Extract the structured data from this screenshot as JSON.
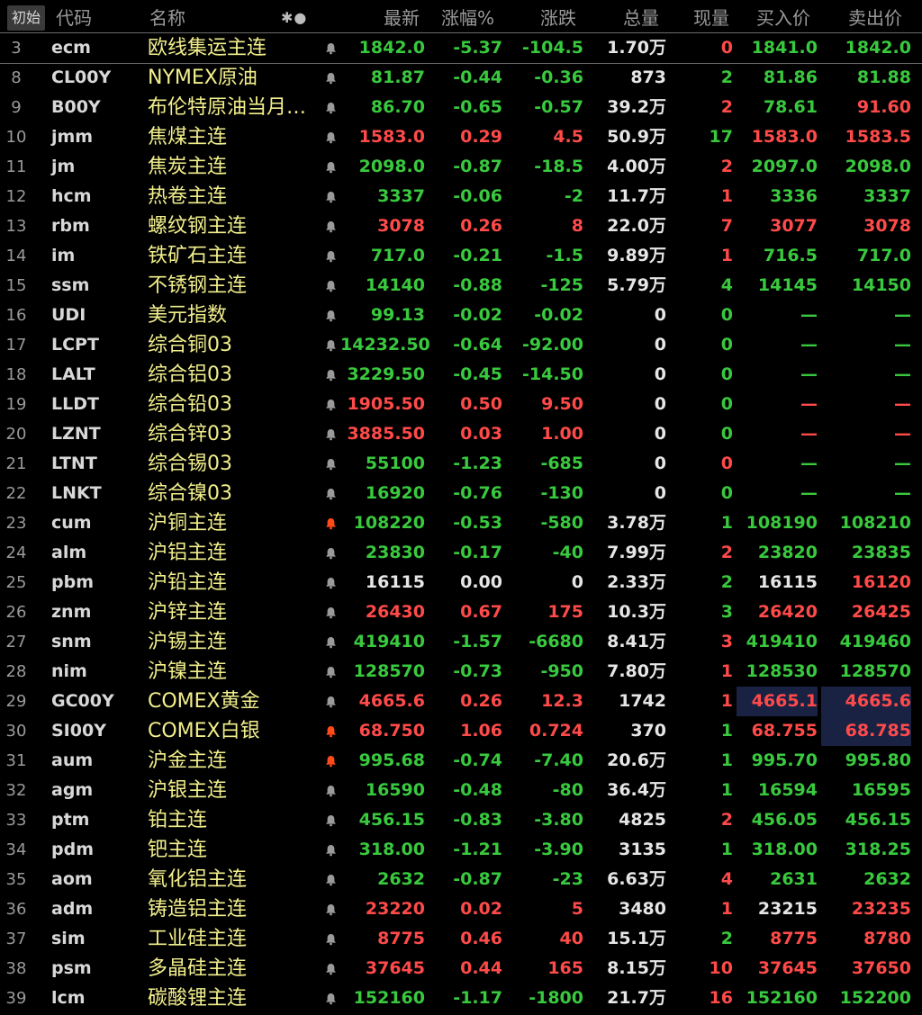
{
  "header": {
    "init_button": "初始",
    "cols": {
      "code": "代码",
      "name": "名称",
      "star": "✱●",
      "last": "最新",
      "pct": "涨幅%",
      "chg": "涨跌",
      "vol": "总量",
      "cur": "现量",
      "bid": "买入价",
      "ask": "卖出价"
    }
  },
  "colors": {
    "up": "#ff4a4a",
    "down": "#39c93e",
    "flat": "#e6e6e6",
    "name": "#f2ef8c",
    "bell_active": "#ff4a1a",
    "bell_idle": "#9a9a9a"
  },
  "rows": [
    {
      "no": "3",
      "code": "ecm",
      "name": "欧线集运主连",
      "bell": "idle",
      "last": "1842.0",
      "pct": "-5.37",
      "chg": "-104.5",
      "vol": "1.70万",
      "cur": "0",
      "bid": "1841.0",
      "ask": "1842.0",
      "c": "g",
      "cc": "red"
    },
    {
      "no": "8",
      "code": "CL00Y",
      "name": "NYMEX原油",
      "bell": "idle",
      "last": "81.87",
      "pct": "-0.44",
      "chg": "-0.36",
      "vol": "873",
      "cur": "2",
      "bid": "81.86",
      "ask": "81.88",
      "c": "g",
      "cc": "g"
    },
    {
      "no": "9",
      "code": "B00Y",
      "name": "布伦特原油当月连续",
      "bell": "idle",
      "last": "86.70",
      "pct": "-0.65",
      "chg": "-0.57",
      "vol": "39.2万",
      "cur": "2",
      "bid": "78.61",
      "ask": "91.60",
      "c": "g",
      "cc": "red",
      "bidc": "g",
      "askc": "red"
    },
    {
      "no": "10",
      "code": "jmm",
      "name": "焦煤主连",
      "bell": "idle",
      "last": "1583.0",
      "pct": "0.29",
      "chg": "4.5",
      "vol": "50.9万",
      "cur": "17",
      "bid": "1583.0",
      "ask": "1583.5",
      "c": "red",
      "cc": "g"
    },
    {
      "no": "11",
      "code": "jm",
      "name": "焦炭主连",
      "bell": "idle",
      "last": "2098.0",
      "pct": "-0.87",
      "chg": "-18.5",
      "vol": "4.00万",
      "cur": "2",
      "bid": "2097.0",
      "ask": "2098.0",
      "c": "g",
      "cc": "red"
    },
    {
      "no": "12",
      "code": "hcm",
      "name": "热卷主连",
      "bell": "idle",
      "last": "3337",
      "pct": "-0.06",
      "chg": "-2",
      "vol": "11.7万",
      "cur": "1",
      "bid": "3336",
      "ask": "3337",
      "c": "g",
      "cc": "red"
    },
    {
      "no": "13",
      "code": "rbm",
      "name": "螺纹钢主连",
      "bell": "idle",
      "last": "3078",
      "pct": "0.26",
      "chg": "8",
      "vol": "22.0万",
      "cur": "7",
      "bid": "3077",
      "ask": "3078",
      "c": "red",
      "cc": "red"
    },
    {
      "no": "14",
      "code": "im",
      "name": "铁矿石主连",
      "bell": "idle",
      "last": "717.0",
      "pct": "-0.21",
      "chg": "-1.5",
      "vol": "9.89万",
      "cur": "1",
      "bid": "716.5",
      "ask": "717.0",
      "c": "g",
      "cc": "red"
    },
    {
      "no": "15",
      "code": "ssm",
      "name": "不锈钢主连",
      "bell": "idle",
      "last": "14140",
      "pct": "-0.88",
      "chg": "-125",
      "vol": "5.79万",
      "cur": "4",
      "bid": "14145",
      "ask": "14150",
      "c": "g",
      "cc": "g"
    },
    {
      "no": "16",
      "code": "UDI",
      "name": "美元指数",
      "bell": "idle",
      "last": "99.13",
      "pct": "-0.02",
      "chg": "-0.02",
      "vol": "0",
      "cur": "0",
      "bid": "—",
      "ask": "—",
      "c": "g",
      "cc": "g"
    },
    {
      "no": "17",
      "code": "LCPT",
      "name": "综合铜03",
      "bell": "idle",
      "last": "14232.50",
      "pct": "-0.64",
      "chg": "-92.00",
      "vol": "0",
      "cur": "0",
      "bid": "—",
      "ask": "—",
      "c": "g",
      "cc": "g"
    },
    {
      "no": "18",
      "code": "LALT",
      "name": "综合铝03",
      "bell": "idle",
      "last": "3229.50",
      "pct": "-0.45",
      "chg": "-14.50",
      "vol": "0",
      "cur": "0",
      "bid": "—",
      "ask": "—",
      "c": "g",
      "cc": "g"
    },
    {
      "no": "19",
      "code": "LLDT",
      "name": "综合铅03",
      "bell": "idle",
      "last": "1905.50",
      "pct": "0.50",
      "chg": "9.50",
      "vol": "0",
      "cur": "0",
      "bid": "—",
      "ask": "—",
      "c": "red",
      "cc": "g"
    },
    {
      "no": "20",
      "code": "LZNT",
      "name": "综合锌03",
      "bell": "idle",
      "last": "3885.50",
      "pct": "0.03",
      "chg": "1.00",
      "vol": "0",
      "cur": "0",
      "bid": "—",
      "ask": "—",
      "c": "red",
      "cc": "g"
    },
    {
      "no": "21",
      "code": "LTNT",
      "name": "综合锡03",
      "bell": "idle",
      "last": "55100",
      "pct": "-1.23",
      "chg": "-685",
      "vol": "0",
      "cur": "0",
      "bid": "—",
      "ask": "—",
      "c": "g",
      "cc": "red"
    },
    {
      "no": "22",
      "code": "LNKT",
      "name": "综合镍03",
      "bell": "idle",
      "last": "16920",
      "pct": "-0.76",
      "chg": "-130",
      "vol": "0",
      "cur": "0",
      "bid": "—",
      "ask": "—",
      "c": "g",
      "cc": "g"
    },
    {
      "no": "23",
      "code": "cum",
      "name": "沪铜主连",
      "bell": "active",
      "last": "108220",
      "pct": "-0.53",
      "chg": "-580",
      "vol": "3.78万",
      "cur": "1",
      "bid": "108190",
      "ask": "108210",
      "c": "g",
      "cc": "g"
    },
    {
      "no": "24",
      "code": "alm",
      "name": "沪铝主连",
      "bell": "idle",
      "last": "23830",
      "pct": "-0.17",
      "chg": "-40",
      "vol": "7.99万",
      "cur": "2",
      "bid": "23820",
      "ask": "23835",
      "c": "g",
      "cc": "red"
    },
    {
      "no": "25",
      "code": "pbm",
      "name": "沪铅主连",
      "bell": "idle",
      "last": "16115",
      "pct": "0.00",
      "chg": "0",
      "vol": "2.33万",
      "cur": "2",
      "bid": "16115",
      "ask": "16120",
      "c": "w",
      "cc": "g",
      "bidc": "w",
      "askc": "red"
    },
    {
      "no": "26",
      "code": "znm",
      "name": "沪锌主连",
      "bell": "idle",
      "last": "26430",
      "pct": "0.67",
      "chg": "175",
      "vol": "10.3万",
      "cur": "3",
      "bid": "26420",
      "ask": "26425",
      "c": "red",
      "cc": "g"
    },
    {
      "no": "27",
      "code": "snm",
      "name": "沪锡主连",
      "bell": "idle",
      "last": "419410",
      "pct": "-1.57",
      "chg": "-6680",
      "vol": "8.41万",
      "cur": "3",
      "bid": "419410",
      "ask": "419460",
      "c": "g",
      "cc": "red"
    },
    {
      "no": "28",
      "code": "nim",
      "name": "沪镍主连",
      "bell": "idle",
      "last": "128570",
      "pct": "-0.73",
      "chg": "-950",
      "vol": "7.80万",
      "cur": "1",
      "bid": "128530",
      "ask": "128570",
      "c": "g",
      "cc": "red"
    },
    {
      "no": "29",
      "code": "GC00Y",
      "name": "COMEX黄金",
      "bell": "idle",
      "last": "4665.6",
      "pct": "0.26",
      "chg": "12.3",
      "vol": "1742",
      "cur": "1",
      "bid": "4665.1",
      "ask": "4665.6",
      "c": "red",
      "cc": "red",
      "hl": "bidask"
    },
    {
      "no": "30",
      "code": "SI00Y",
      "name": "COMEX白银",
      "bell": "active",
      "last": "68.750",
      "pct": "1.06",
      "chg": "0.724",
      "vol": "370",
      "cur": "1",
      "bid": "68.755",
      "ask": "68.785",
      "c": "red",
      "cc": "g",
      "hl": "ask"
    },
    {
      "no": "31",
      "code": "aum",
      "name": "沪金主连",
      "bell": "active",
      "last": "995.68",
      "pct": "-0.74",
      "chg": "-7.40",
      "vol": "20.6万",
      "cur": "1",
      "bid": "995.70",
      "ask": "995.80",
      "c": "g",
      "cc": "g"
    },
    {
      "no": "32",
      "code": "agm",
      "name": "沪银主连",
      "bell": "idle",
      "last": "16590",
      "pct": "-0.48",
      "chg": "-80",
      "vol": "36.4万",
      "cur": "1",
      "bid": "16594",
      "ask": "16595",
      "c": "g",
      "cc": "g"
    },
    {
      "no": "33",
      "code": "ptm",
      "name": "铂主连",
      "bell": "idle",
      "last": "456.15",
      "pct": "-0.83",
      "chg": "-3.80",
      "vol": "4825",
      "cur": "2",
      "bid": "456.05",
      "ask": "456.15",
      "c": "g",
      "cc": "red"
    },
    {
      "no": "34",
      "code": "pdm",
      "name": "钯主连",
      "bell": "idle",
      "last": "318.00",
      "pct": "-1.21",
      "chg": "-3.90",
      "vol": "3135",
      "cur": "1",
      "bid": "318.00",
      "ask": "318.25",
      "c": "g",
      "cc": "g"
    },
    {
      "no": "35",
      "code": "aom",
      "name": "氧化铝主连",
      "bell": "idle",
      "last": "2632",
      "pct": "-0.87",
      "chg": "-23",
      "vol": "6.63万",
      "cur": "4",
      "bid": "2631",
      "ask": "2632",
      "c": "g",
      "cc": "red"
    },
    {
      "no": "36",
      "code": "adm",
      "name": "铸造铝主连",
      "bell": "idle",
      "last": "23220",
      "pct": "0.02",
      "chg": "5",
      "vol": "3480",
      "cur": "1",
      "bid": "23215",
      "ask": "23235",
      "c": "red",
      "cc": "red",
      "bidc": "w",
      "askc": "red"
    },
    {
      "no": "37",
      "code": "sim",
      "name": "工业硅主连",
      "bell": "idle",
      "last": "8775",
      "pct": "0.46",
      "chg": "40",
      "vol": "15.1万",
      "cur": "2",
      "bid": "8775",
      "ask": "8780",
      "c": "red",
      "cc": "g"
    },
    {
      "no": "38",
      "code": "psm",
      "name": "多晶硅主连",
      "bell": "idle",
      "last": "37645",
      "pct": "0.44",
      "chg": "165",
      "vol": "8.15万",
      "cur": "10",
      "bid": "37645",
      "ask": "37650",
      "c": "red",
      "cc": "red"
    },
    {
      "no": "39",
      "code": "lcm",
      "name": "碳酸锂主连",
      "bell": "idle",
      "last": "152160",
      "pct": "-1.17",
      "chg": "-1800",
      "vol": "21.7万",
      "cur": "16",
      "bid": "152160",
      "ask": "152200",
      "c": "g",
      "cc": "red"
    }
  ]
}
